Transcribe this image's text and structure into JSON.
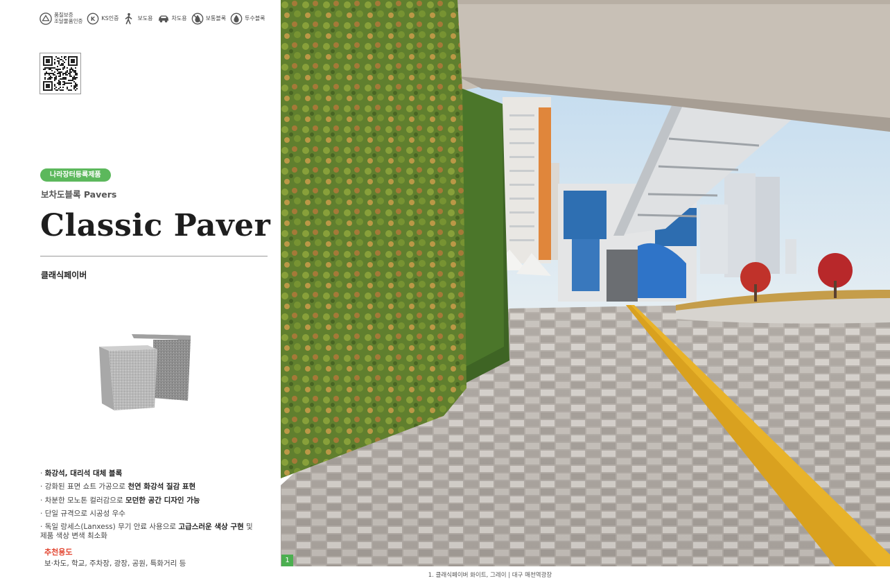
{
  "certs": [
    {
      "icon": "quality-seal-icon",
      "line1": "품질보증",
      "line2": "조달물품인증"
    },
    {
      "icon": "ks-mark-icon",
      "label": "KS인증"
    },
    {
      "icon": "pedestrian-icon",
      "label": "보도용"
    },
    {
      "icon": "car-icon",
      "label": "차도용"
    },
    {
      "icon": "no-water-icon",
      "label": "보통블록"
    },
    {
      "icon": "permeable-icon",
      "label": "투수블록"
    }
  ],
  "badge": "나라장터등록제품",
  "category": "보차도블록 Pavers",
  "title": "Classic Paver",
  "korean_name": "클래식페이버",
  "features": [
    {
      "pre": "· ",
      "text": "",
      "bold": "화강석, 대리석 대체 블록",
      "post": ""
    },
    {
      "pre": "· ",
      "text": "강화된 표면 쇼트 가공으로 ",
      "bold": "천연 화강석 질감 표현",
      "post": ""
    },
    {
      "pre": "· ",
      "text": "차분한 모노톤 컬러감으로 ",
      "bold": "모던한 공간 디자인 가능",
      "post": ""
    },
    {
      "pre": "· ",
      "text": "단일 규격으로 시공성 우수",
      "bold": "",
      "post": ""
    },
    {
      "pre": "· ",
      "text": "독일 랑세스(Lanxess) 무기 안료 사용으로 ",
      "bold": "고급스러운 색상 구현",
      "post": " 및"
    },
    {
      "pre": "",
      "text": "  제품 색상 변색 최소화",
      "bold": "",
      "post": ""
    }
  ],
  "usage_heading": "추천용도",
  "usage_text": "보·차도, 학교, 주차장, 광장, 공원, 특화거리 등",
  "figure_number": "1",
  "caption": "1. 클래식페이버 화이트, 그레이 | 대구 매천역광장",
  "colors": {
    "accent_green": "#5cb85c",
    "usage_red": "#e2442f"
  }
}
